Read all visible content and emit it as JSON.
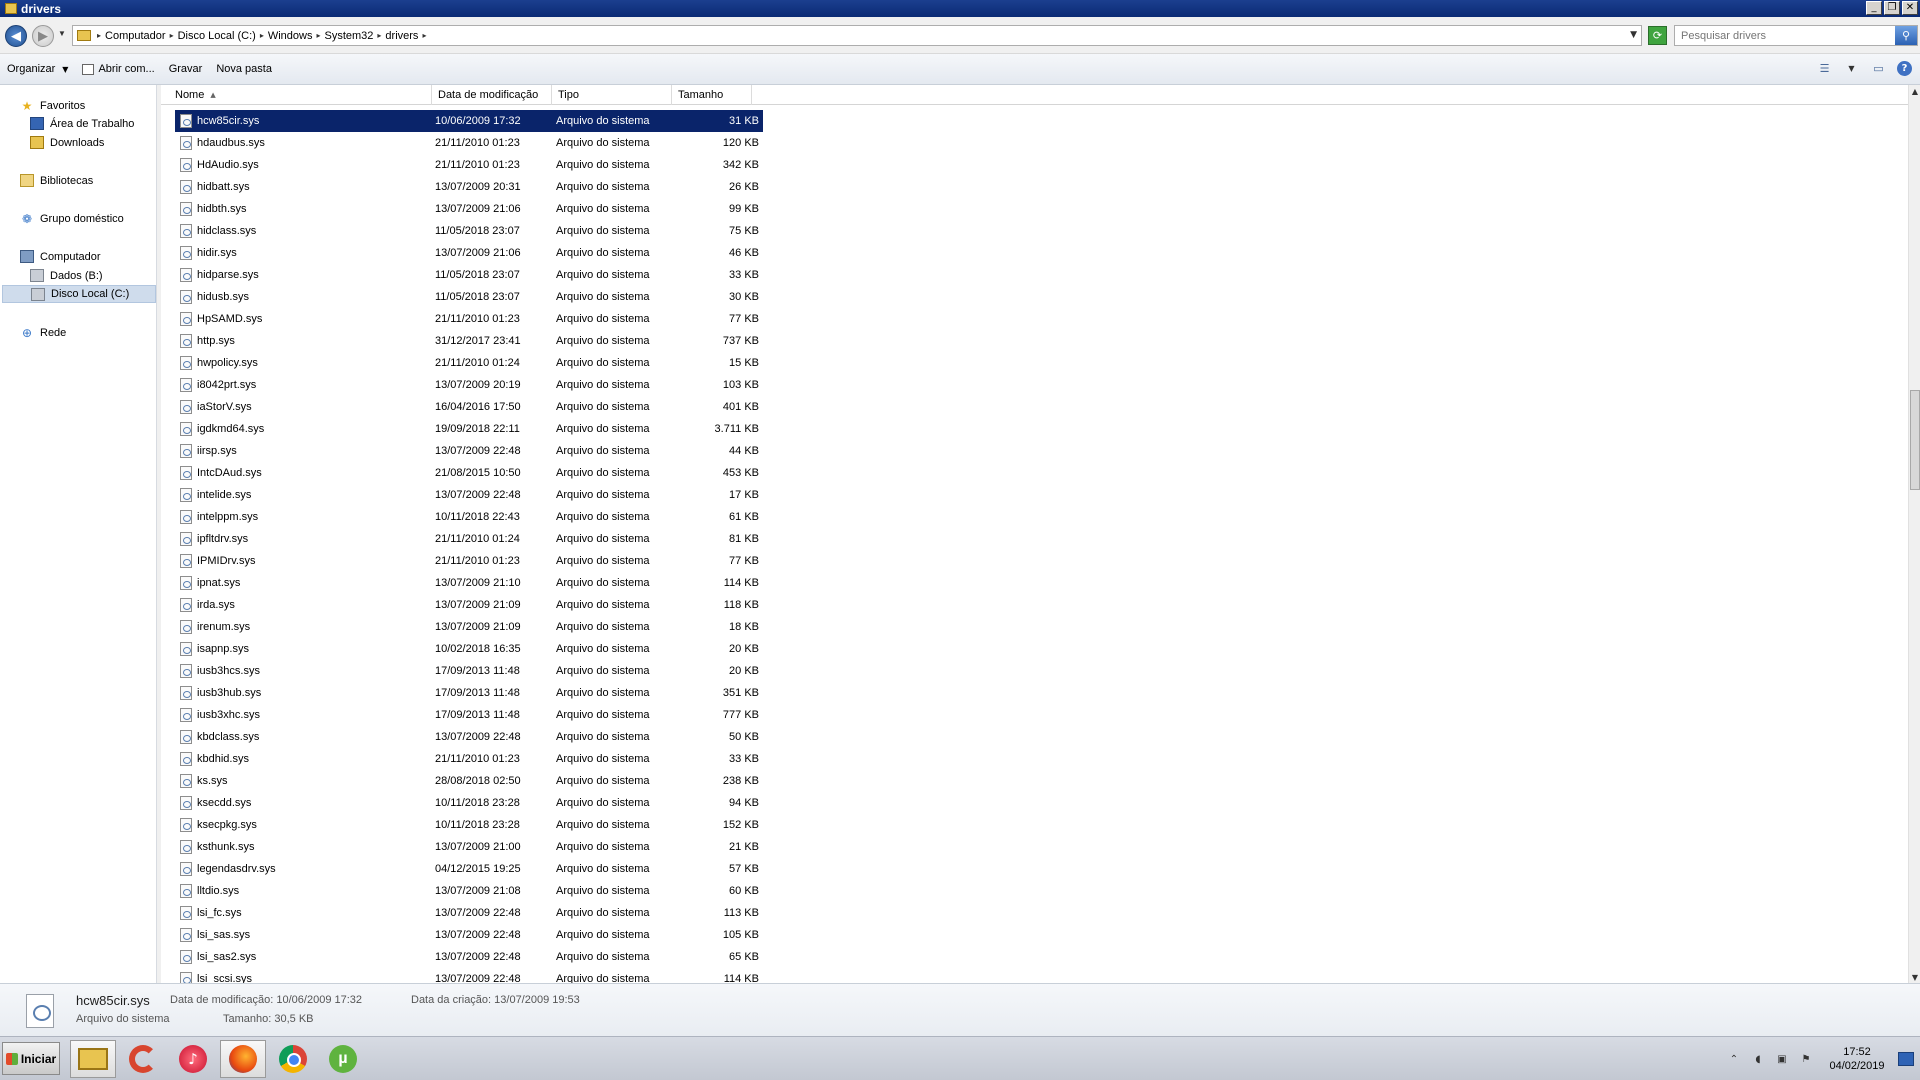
{
  "window": {
    "title": "drivers"
  },
  "address": {
    "crumbs": [
      "Computador",
      "Disco Local (C:)",
      "Windows",
      "System32",
      "drivers"
    ]
  },
  "search": {
    "placeholder": "Pesquisar drivers"
  },
  "toolbar": {
    "organize_label": "Organizar",
    "open_with_label": "Abrir com...",
    "burn_label": "Gravar",
    "new_folder_label": "Nova pasta"
  },
  "navpane": {
    "favorites": "Favoritos",
    "desktop": "Área de Trabalho",
    "downloads": "Downloads",
    "libraries": "Bibliotecas",
    "homegroup": "Grupo doméstico",
    "computer": "Computador",
    "drive_b": "Dados (B:)",
    "drive_c": "Disco Local (C:)",
    "network": "Rede"
  },
  "columns": {
    "name": "Nome",
    "modified": "Data de modificação",
    "type": "Tipo",
    "size": "Tamanho"
  },
  "files": [
    {
      "name": "hcw85cir.sys",
      "date": "10/06/2009 17:32",
      "type": "Arquivo do sistema",
      "size": "31 KB"
    },
    {
      "name": "hdaudbus.sys",
      "date": "21/11/2010 01:23",
      "type": "Arquivo do sistema",
      "size": "120 KB"
    },
    {
      "name": "HdAudio.sys",
      "date": "21/11/2010 01:23",
      "type": "Arquivo do sistema",
      "size": "342 KB"
    },
    {
      "name": "hidbatt.sys",
      "date": "13/07/2009 20:31",
      "type": "Arquivo do sistema",
      "size": "26 KB"
    },
    {
      "name": "hidbth.sys",
      "date": "13/07/2009 21:06",
      "type": "Arquivo do sistema",
      "size": "99 KB"
    },
    {
      "name": "hidclass.sys",
      "date": "11/05/2018 23:07",
      "type": "Arquivo do sistema",
      "size": "75 KB"
    },
    {
      "name": "hidir.sys",
      "date": "13/07/2009 21:06",
      "type": "Arquivo do sistema",
      "size": "46 KB"
    },
    {
      "name": "hidparse.sys",
      "date": "11/05/2018 23:07",
      "type": "Arquivo do sistema",
      "size": "33 KB"
    },
    {
      "name": "hidusb.sys",
      "date": "11/05/2018 23:07",
      "type": "Arquivo do sistema",
      "size": "30 KB"
    },
    {
      "name": "HpSAMD.sys",
      "date": "21/11/2010 01:23",
      "type": "Arquivo do sistema",
      "size": "77 KB"
    },
    {
      "name": "http.sys",
      "date": "31/12/2017 23:41",
      "type": "Arquivo do sistema",
      "size": "737 KB"
    },
    {
      "name": "hwpolicy.sys",
      "date": "21/11/2010 01:24",
      "type": "Arquivo do sistema",
      "size": "15 KB"
    },
    {
      "name": "i8042prt.sys",
      "date": "13/07/2009 20:19",
      "type": "Arquivo do sistema",
      "size": "103 KB"
    },
    {
      "name": "iaStorV.sys",
      "date": "16/04/2016 17:50",
      "type": "Arquivo do sistema",
      "size": "401 KB"
    },
    {
      "name": "igdkmd64.sys",
      "date": "19/09/2018 22:11",
      "type": "Arquivo do sistema",
      "size": "3.711 KB"
    },
    {
      "name": "iirsp.sys",
      "date": "13/07/2009 22:48",
      "type": "Arquivo do sistema",
      "size": "44 KB"
    },
    {
      "name": "IntcDAud.sys",
      "date": "21/08/2015 10:50",
      "type": "Arquivo do sistema",
      "size": "453 KB"
    },
    {
      "name": "intelide.sys",
      "date": "13/07/2009 22:48",
      "type": "Arquivo do sistema",
      "size": "17 KB"
    },
    {
      "name": "intelppm.sys",
      "date": "10/11/2018 22:43",
      "type": "Arquivo do sistema",
      "size": "61 KB"
    },
    {
      "name": "ipfltdrv.sys",
      "date": "21/11/2010 01:24",
      "type": "Arquivo do sistema",
      "size": "81 KB"
    },
    {
      "name": "IPMIDrv.sys",
      "date": "21/11/2010 01:23",
      "type": "Arquivo do sistema",
      "size": "77 KB"
    },
    {
      "name": "ipnat.sys",
      "date": "13/07/2009 21:10",
      "type": "Arquivo do sistema",
      "size": "114 KB"
    },
    {
      "name": "irda.sys",
      "date": "13/07/2009 21:09",
      "type": "Arquivo do sistema",
      "size": "118 KB"
    },
    {
      "name": "irenum.sys",
      "date": "13/07/2009 21:09",
      "type": "Arquivo do sistema",
      "size": "18 KB"
    },
    {
      "name": "isapnp.sys",
      "date": "10/02/2018 16:35",
      "type": "Arquivo do sistema",
      "size": "20 KB"
    },
    {
      "name": "iusb3hcs.sys",
      "date": "17/09/2013 11:48",
      "type": "Arquivo do sistema",
      "size": "20 KB"
    },
    {
      "name": "iusb3hub.sys",
      "date": "17/09/2013 11:48",
      "type": "Arquivo do sistema",
      "size": "351 KB"
    },
    {
      "name": "iusb3xhc.sys",
      "date": "17/09/2013 11:48",
      "type": "Arquivo do sistema",
      "size": "777 KB"
    },
    {
      "name": "kbdclass.sys",
      "date": "13/07/2009 22:48",
      "type": "Arquivo do sistema",
      "size": "50 KB"
    },
    {
      "name": "kbdhid.sys",
      "date": "21/11/2010 01:23",
      "type": "Arquivo do sistema",
      "size": "33 KB"
    },
    {
      "name": "ks.sys",
      "date": "28/08/2018 02:50",
      "type": "Arquivo do sistema",
      "size": "238 KB"
    },
    {
      "name": "ksecdd.sys",
      "date": "10/11/2018 23:28",
      "type": "Arquivo do sistema",
      "size": "94 KB"
    },
    {
      "name": "ksecpkg.sys",
      "date": "10/11/2018 23:28",
      "type": "Arquivo do sistema",
      "size": "152 KB"
    },
    {
      "name": "ksthunk.sys",
      "date": "13/07/2009 21:00",
      "type": "Arquivo do sistema",
      "size": "21 KB"
    },
    {
      "name": "legendasdrv.sys",
      "date": "04/12/2015 19:25",
      "type": "Arquivo do sistema",
      "size": "57 KB"
    },
    {
      "name": "lltdio.sys",
      "date": "13/07/2009 21:08",
      "type": "Arquivo do sistema",
      "size": "60 KB"
    },
    {
      "name": "lsi_fc.sys",
      "date": "13/07/2009 22:48",
      "type": "Arquivo do sistema",
      "size": "113 KB"
    },
    {
      "name": "lsi_sas.sys",
      "date": "13/07/2009 22:48",
      "type": "Arquivo do sistema",
      "size": "105 KB"
    },
    {
      "name": "lsi_sas2.sys",
      "date": "13/07/2009 22:48",
      "type": "Arquivo do sistema",
      "size": "65 KB"
    },
    {
      "name": "lsi_scsi.sys",
      "date": "13/07/2009 22:48",
      "type": "Arquivo do sistema",
      "size": "114 KB"
    }
  ],
  "details": {
    "name": "hcw85cir.sys",
    "type": "Arquivo do sistema",
    "modified": "Data de modificação: 10/06/2009 17:32",
    "size": "Tamanho: 30,5 KB",
    "created": "Data da criação: 13/07/2009 19:53"
  },
  "taskbar": {
    "start_label": "Iniciar",
    "time": "17:52",
    "date": "04/02/2019"
  }
}
